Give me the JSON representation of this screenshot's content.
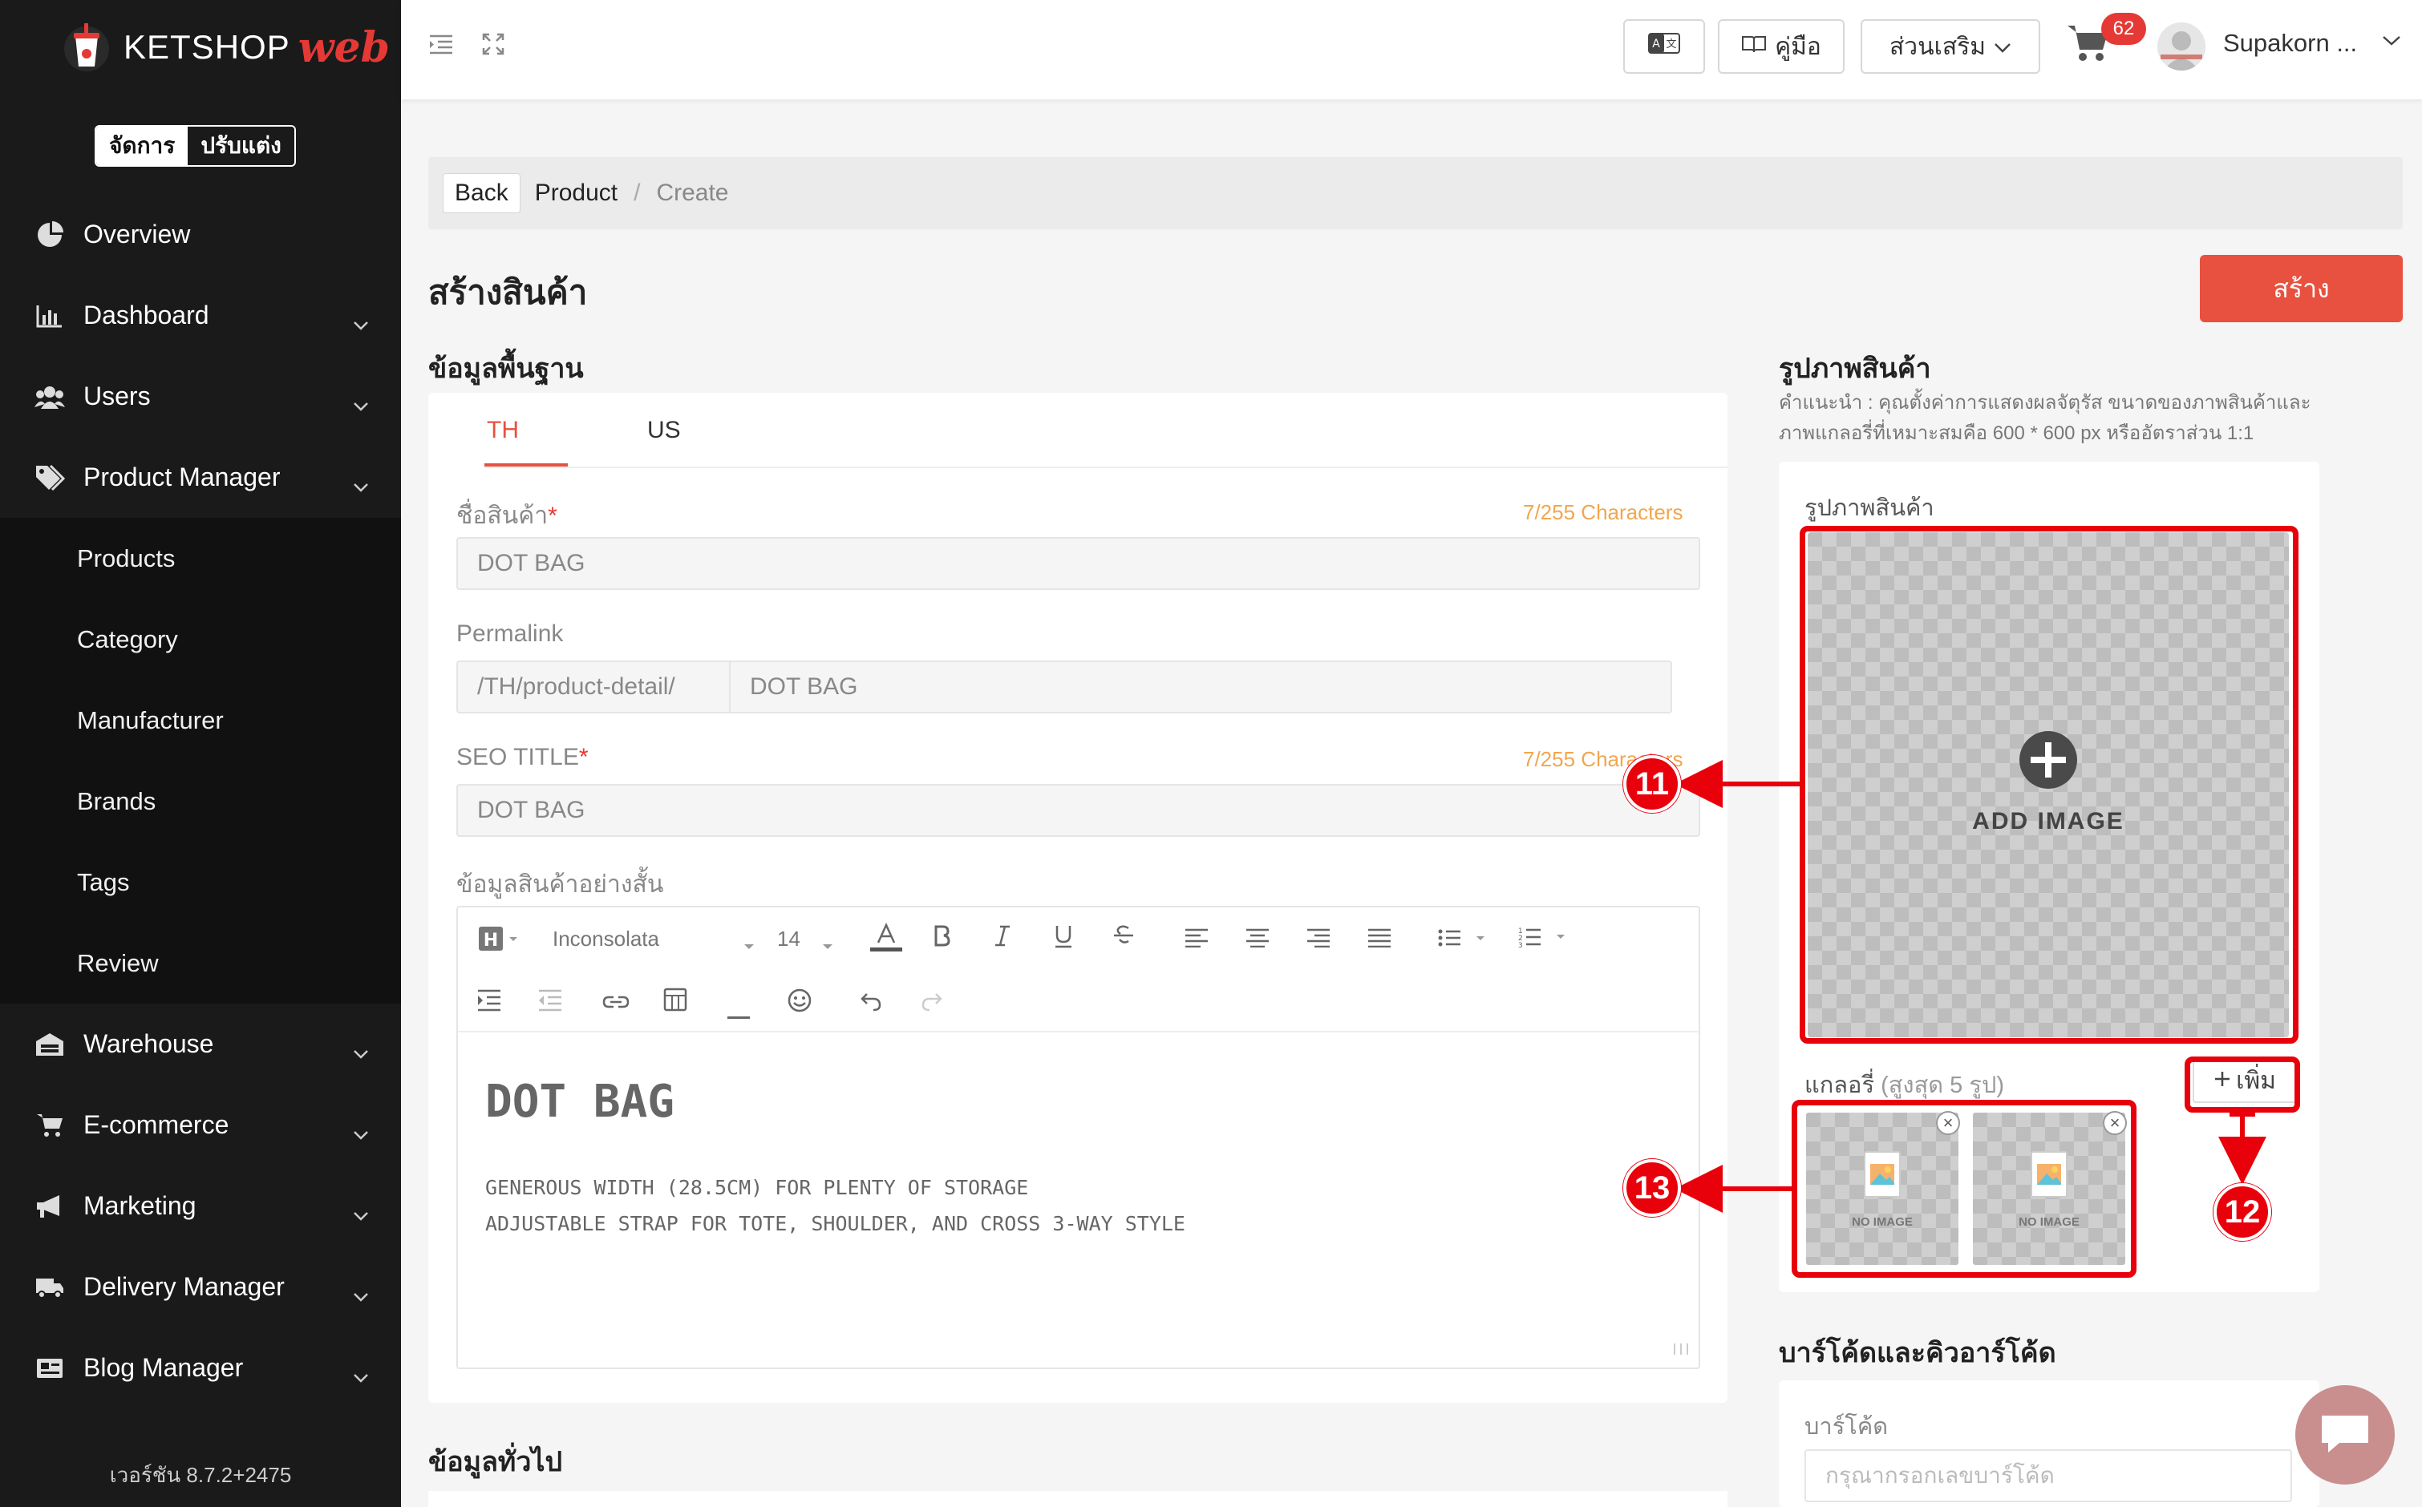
{
  "brand": {
    "name": "KETSHOP",
    "suffix": "web"
  },
  "mode_toggle": {
    "manage": "จัดการ",
    "customize": "ปรับแต่ง"
  },
  "sidebar": {
    "items": [
      {
        "label": "Overview",
        "icon": "pie-chart-icon",
        "has_chevron": false
      },
      {
        "label": "Dashboard",
        "icon": "bar-chart-icon",
        "has_chevron": true
      },
      {
        "label": "Users",
        "icon": "users-icon",
        "has_chevron": true
      },
      {
        "label": "Product Manager",
        "icon": "tags-icon",
        "has_chevron": true
      }
    ],
    "sub_items": [
      "Products",
      "Category",
      "Manufacturer",
      "Brands",
      "Tags",
      "Review"
    ],
    "items_after": [
      {
        "label": "Warehouse",
        "icon": "warehouse-icon"
      },
      {
        "label": "E-commerce",
        "icon": "cart-icon"
      },
      {
        "label": "Marketing",
        "icon": "megaphone-icon"
      },
      {
        "label": "Delivery Manager",
        "icon": "truck-icon"
      },
      {
        "label": "Blog Manager",
        "icon": "newspaper-icon"
      }
    ],
    "version": "เวอร์ชัน 8.7.2+2475"
  },
  "header": {
    "manual_label": "คู่มือ",
    "addons_label": "ส่วนเสริม",
    "cart_count": "62",
    "user_name": "Supakorn ..."
  },
  "breadcrumb": {
    "back": "Back",
    "product": "Product",
    "sep": "/",
    "current": "Create"
  },
  "page": {
    "title": "สร้างสินค้า",
    "create_button": "สร้าง"
  },
  "basic_info": {
    "section_title": "ข้อมูลพื้นฐาน",
    "tabs": [
      "TH",
      "US"
    ],
    "active_tab": "TH",
    "name_label": "ชื่อสินค้า",
    "required_mark": "*",
    "name_counter": "7/255 Characters",
    "name_value": "DOT BAG",
    "permalink_label": "Permalink",
    "permalink_prefix": "/TH/product-detail/",
    "permalink_value": "DOT BAG",
    "seo_label": "SEO TITLE",
    "seo_counter": "7/255 Characters",
    "seo_value": "DOT BAG",
    "short_desc_label": "ข้อมูลสินค้าอย่างสั้น"
  },
  "editor": {
    "font": "Inconsolata",
    "size": "14",
    "heading": "DOT BAG",
    "lines": [
      "GENEROUS WIDTH (28.5CM) FOR PLENTY OF STORAGE",
      "ADJUSTABLE STRAP FOR TOTE, SHOULDER, AND CROSS 3-WAY STYLE"
    ]
  },
  "images": {
    "section_title": "รูปภาพสินค้า",
    "hint_line1": "คำแนะนำ : คุณตั้งค่าการแสดงผลจัตุรัส ขนาดของภาพสินค้าและ",
    "hint_line2": "ภาพแกลอรี่ที่เหมาะสมคือ 600 * 600 px หรืออัตราส่วน 1:1",
    "card_label": "รูปภาพสินค้า",
    "add_image": "ADD IMAGE",
    "gallery_label": "แกลอรี่",
    "gallery_limit": "(สูงสุด 5 รูป)",
    "add_more": "เพิ่ม",
    "thumbs": [
      {
        "label": "NO IMAGE"
      },
      {
        "label": "NO IMAGE"
      }
    ]
  },
  "barcode": {
    "section_title": "บาร์โค้ดและคิวอาร์โค้ด",
    "label": "บาร์โค้ด",
    "placeholder": "กรุณากรอกเลขบาร์โค้ด"
  },
  "general": {
    "section_title": "ข้อมูลทั่วไป"
  },
  "annotations": {
    "c11": "11",
    "c12": "12",
    "c13": "13"
  },
  "colors": {
    "accent": "#e8513f",
    "annotation": "#e8000b",
    "sidebar": "#1a1a1a",
    "counter": "#f2a64e"
  }
}
